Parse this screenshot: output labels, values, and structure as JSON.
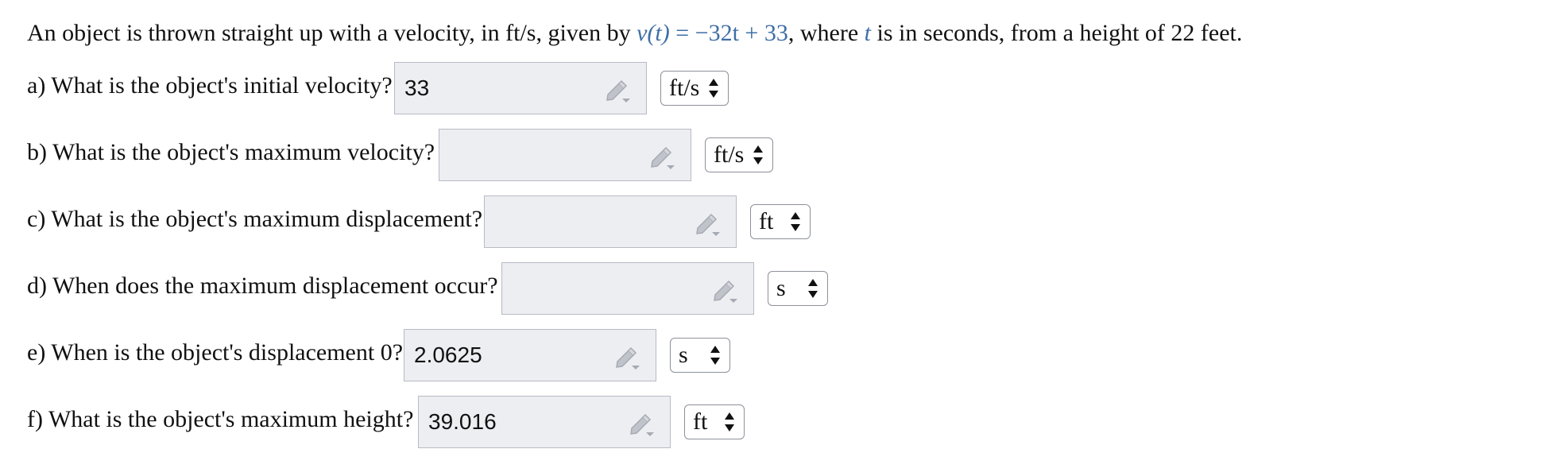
{
  "problem": {
    "before_formula": "An object is thrown straight up with a velocity, in ft/s, given by ",
    "formula_lhs": "v(t)",
    "formula_rhs": " = −32t + 33",
    "after_formula_1": ", where ",
    "variable_t": "t",
    "after_formula_2": " is in seconds, from a height of 22 feet."
  },
  "questions": [
    {
      "label": "a) What is the object's initial velocity?",
      "answer": "33",
      "unit": "ft/s"
    },
    {
      "label": "b) What is the object's maximum velocity?",
      "answer": "",
      "unit": "ft/s"
    },
    {
      "label": "c) What is the object's maximum displacement?",
      "answer": "",
      "unit": "ft"
    },
    {
      "label": "d) When does the maximum displacement occur?",
      "answer": "",
      "unit": "s"
    },
    {
      "label": "e) When is the object's displacement 0?",
      "answer": "2.0625",
      "unit": "s"
    },
    {
      "label": "f) What is the object's maximum height?",
      "answer": "39.016",
      "unit": "ft"
    }
  ],
  "icons": {
    "edit": "pencil-edit-icon",
    "select": "up-down-arrows-icon"
  },
  "colors": {
    "formula": "#3f6fa6",
    "answer_box": "#eceef2",
    "icon": "#b9bcc4"
  }
}
